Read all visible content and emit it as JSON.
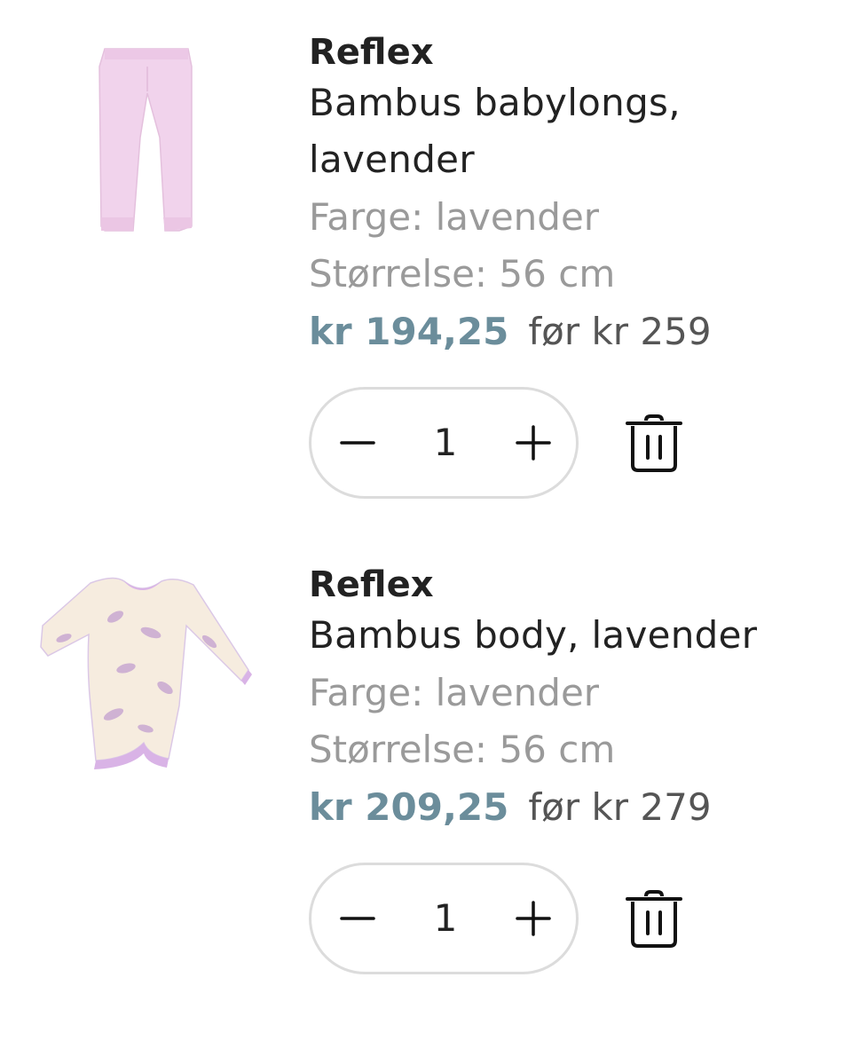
{
  "cart": {
    "items": [
      {
        "brand": "Reflex",
        "name_line1": "Bambus babylongs,",
        "name_line2": "lavender",
        "color": "Farge: lavender",
        "size": "Størrelse: 56 cm",
        "price_now": "kr 194,25",
        "price_was": "før kr 259",
        "quantity": "1",
        "image": "pink-baby-leggings"
      },
      {
        "brand": "Reflex",
        "name_line1": "Bambus body, lavender",
        "name_line2": "",
        "color": "Farge: lavender",
        "size": "Størrelse: 56 cm",
        "price_now": "kr 209,25",
        "price_was": "før kr 279",
        "quantity": "1",
        "image": "floral-longsleeve-bodysuit"
      }
    ]
  },
  "colors": {
    "price_now": "#6b8d9b",
    "meta_text": "#9a9a9a",
    "stepper_border": "#dcdcdc",
    "leggings": "#f1d3ec",
    "body_base": "#f6ecdf",
    "body_trim": "#d9b3e6"
  },
  "icons": [
    "minus-icon",
    "plus-icon",
    "trash-icon"
  ]
}
